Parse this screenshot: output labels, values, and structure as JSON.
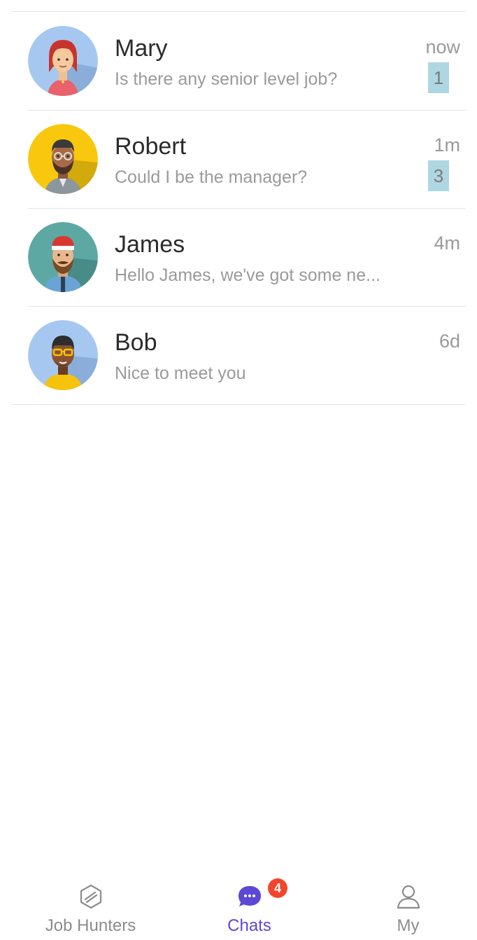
{
  "chats": [
    {
      "name": "Mary",
      "preview": "Is there any senior level job?",
      "time": "now",
      "unread": "1",
      "avatar_icon": "avatar-woman-red-hair-icon"
    },
    {
      "name": "Robert",
      "preview": "Could I be the manager?",
      "time": "1m",
      "unread": "3",
      "avatar_icon": "avatar-man-glasses-beard-icon"
    },
    {
      "name": "James",
      "preview": "Hello James, we've got some ne...",
      "time": "4m",
      "unread": "",
      "avatar_icon": "avatar-man-cap-beard-icon"
    },
    {
      "name": "Bob",
      "preview": "Nice to meet you",
      "time": "6d",
      "unread": "",
      "avatar_icon": "avatar-man-yellow-glasses-icon"
    }
  ],
  "tabs": [
    {
      "label": "Job Hunters",
      "icon": "cube-icon"
    },
    {
      "label": "Chats",
      "icon": "chat-bubble-icon",
      "badge": "4",
      "active": true
    },
    {
      "label": "My",
      "icon": "user-icon"
    }
  ],
  "colors": {
    "accent": "#5b48d6",
    "badge": "#f2452b",
    "unread_bg": "#aed7e2",
    "muted_text": "#9a9a9a"
  }
}
